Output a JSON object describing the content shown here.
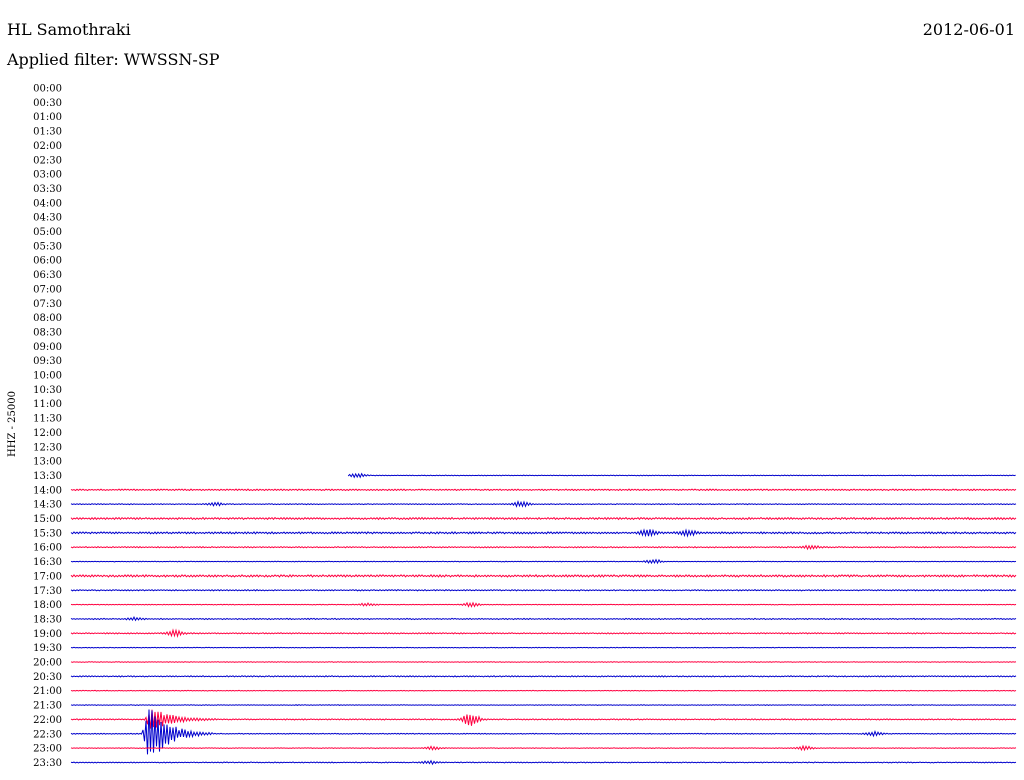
{
  "header": {
    "station": "HL Samothraki",
    "filter_prefix": "Applied filter:",
    "filter_name": "WWSSN-SP",
    "date": "2012-06-01"
  },
  "chart_data": {
    "type": "line",
    "title": "HL Samothraki",
    "date": "2012-06-01",
    "filter": "WWSSN-SP",
    "ylabel": "HHZ - 25000",
    "y_tick_labels": [
      "00:00",
      "00:30",
      "01:00",
      "01:30",
      "02:00",
      "02:30",
      "03:00",
      "03:30",
      "04:00",
      "04:30",
      "05:00",
      "05:30",
      "06:00",
      "06:30",
      "07:00",
      "07:30",
      "08:00",
      "08:30",
      "09:00",
      "09:30",
      "10:00",
      "10:30",
      "11:00",
      "11:30",
      "12:00",
      "12:30",
      "13:00",
      "13:30",
      "14:00",
      "14:30",
      "15:00",
      "15:30",
      "16:00",
      "16:30",
      "17:00",
      "17:30",
      "18:00",
      "18:30",
      "19:00",
      "19:30",
      "20:00",
      "20:30",
      "21:00",
      "21:30",
      "22:00",
      "22:30",
      "23:00",
      "23:30"
    ],
    "x_range_minutes": [
      0,
      30
    ],
    "grid": false,
    "legend": "none",
    "colors": [
      "#ff0040",
      "#0000cc"
    ],
    "series": [
      {
        "start": "13:30",
        "x_start_minute": 8.8,
        "noise": 0.3,
        "events": [
          {
            "x_minute": 9.1,
            "amplitude": 2
          }
        ]
      },
      {
        "start": "14:00",
        "noise": 0.6,
        "events": []
      },
      {
        "start": "14:30",
        "noise": 0.4,
        "events": [
          {
            "x_minute": 14.3,
            "amplitude": 3
          },
          {
            "x_minute": 4.6,
            "amplitude": 1.5
          }
        ]
      },
      {
        "start": "15:00",
        "noise": 0.8,
        "events": []
      },
      {
        "start": "15:30",
        "noise": 0.8,
        "events": [
          {
            "x_minute": 18.3,
            "amplitude": 4
          },
          {
            "x_minute": 19.6,
            "amplitude": 3
          }
        ]
      },
      {
        "start": "16:00",
        "noise": 0.5,
        "events": [
          {
            "x_minute": 23.5,
            "amplitude": 2
          }
        ]
      },
      {
        "start": "16:30",
        "noise": 0.3,
        "events": [
          {
            "x_minute": 18.5,
            "amplitude": 2
          }
        ]
      },
      {
        "start": "17:00",
        "noise": 0.9,
        "events": []
      },
      {
        "start": "17:30",
        "noise": 0.5,
        "events": []
      },
      {
        "start": "18:00",
        "noise": 0.3,
        "events": [
          {
            "x_minute": 12.7,
            "amplitude": 2
          },
          {
            "x_minute": 9.4,
            "amplitude": 1.5
          }
        ]
      },
      {
        "start": "18:30",
        "noise": 0.5,
        "events": [
          {
            "x_minute": 2.0,
            "amplitude": 1.5
          }
        ]
      },
      {
        "start": "19:00",
        "noise": 0.5,
        "events": [
          {
            "x_minute": 3.3,
            "amplitude": 3
          }
        ]
      },
      {
        "start": "19:30",
        "noise": 0.3,
        "events": []
      },
      {
        "start": "20:00",
        "noise": 0.3,
        "events": []
      },
      {
        "start": "20:30",
        "noise": 0.5,
        "events": []
      },
      {
        "start": "21:00",
        "noise": 0.3,
        "events": []
      },
      {
        "start": "21:30",
        "noise": 0.3,
        "events": []
      },
      {
        "start": "22:00",
        "noise": 0.5,
        "events": [
          {
            "x_minute": 2.4,
            "amplitude": 14
          },
          {
            "x_minute": 12.7,
            "amplitude": 7
          }
        ]
      },
      {
        "start": "22:30",
        "noise": 0.4,
        "events": [
          {
            "x_minute": 2.3,
            "amplitude": 34
          },
          {
            "x_minute": 25.5,
            "amplitude": 2
          }
        ]
      },
      {
        "start": "23:00",
        "noise": 0.3,
        "events": [
          {
            "x_minute": 23.3,
            "amplitude": 2
          },
          {
            "x_minute": 11.5,
            "amplitude": 1.5
          }
        ]
      },
      {
        "start": "23:30",
        "noise": 0.4,
        "events": [
          {
            "x_minute": 11.4,
            "amplitude": 1.5
          }
        ]
      }
    ]
  }
}
